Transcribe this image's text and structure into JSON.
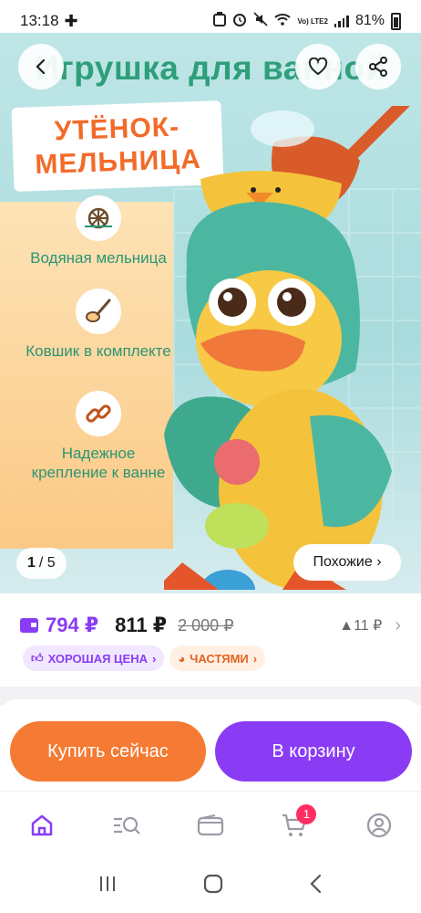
{
  "status_bar": {
    "time": "13:18",
    "battery": "81%",
    "network": "Vo) LTE2"
  },
  "product": {
    "title_overlay": "Игрушка для ванной",
    "subtitle": "УТЁНОК-МЕЛЬНИЦА",
    "features": [
      {
        "icon": "water-wheel-icon",
        "text": "Водяная мельница"
      },
      {
        "icon": "ladle-icon",
        "text": "Ковшик в комплекте"
      },
      {
        "icon": "chain-link-icon",
        "text": "Надежное крепление к ванне"
      }
    ],
    "image_counter_current": "1",
    "image_counter_total": "/ 5",
    "similar_label": "Похожие ›"
  },
  "price": {
    "card_price": "794 ₽",
    "main_price": "811 ₽",
    "old_price": "2 000 ₽",
    "increase": "▲11 ₽",
    "badge_good": "ХОРОШАЯ ЦЕНА",
    "badge_parts": "ЧАСТЯМИ"
  },
  "actions": {
    "buy_now": "Купить сейчас",
    "to_cart": "В корзину"
  },
  "tabbar": {
    "cart_count": "1",
    "active": "home"
  },
  "colors": {
    "accent_purple": "#8a3cf5",
    "accent_orange": "#f57a33",
    "title_green": "#2f9f7a",
    "subtitle_orange": "#f26b2a",
    "badge_red": "#ff2e62"
  }
}
